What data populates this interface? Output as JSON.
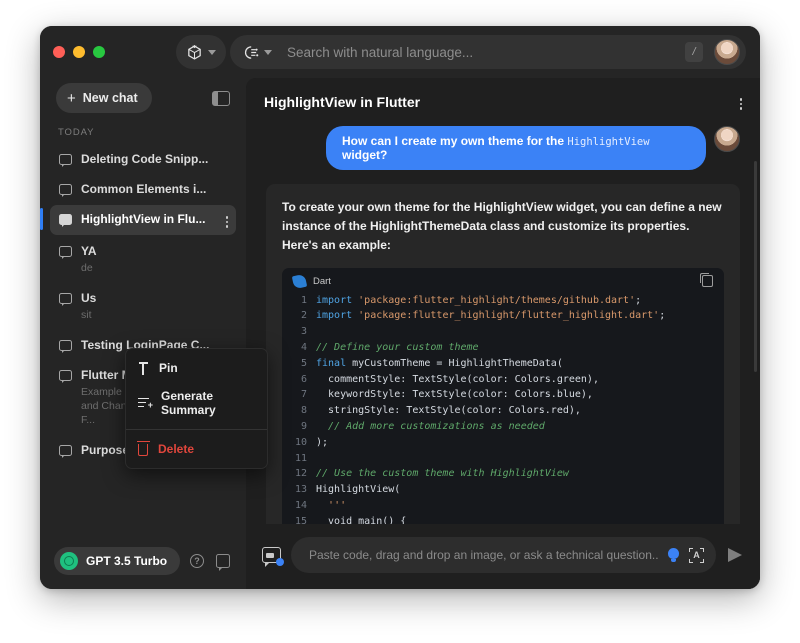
{
  "window": {
    "traffic_lights": [
      "close",
      "minimize",
      "maximize"
    ]
  },
  "toolbar": {
    "cube_icon": "cube-icon",
    "cube_caret": "chevron-down-icon",
    "brain_icon": "brain-plug-icon",
    "brain_caret": "chevron-down-icon",
    "search_placeholder": "Search with natural language...",
    "slash_shortcut": "/",
    "avatar": "user-avatar"
  },
  "sidebar": {
    "new_chat_label": "New chat",
    "panel_toggle_icon": "sidebar-toggle-icon",
    "section_label": "TODAY",
    "items": [
      {
        "title": "Deleting Code Snipp...",
        "subtitle": "",
        "active": false
      },
      {
        "title": "Common Elements i...",
        "subtitle": "",
        "active": false
      },
      {
        "title": "HighlightView in Flu...",
        "subtitle": "",
        "active": true
      },
      {
        "title": "YA",
        "subtitle": "de",
        "active": false
      },
      {
        "title": "Us",
        "subtitle": "sit",
        "active": false
      },
      {
        "title": "Testing LoginPage C...",
        "subtitle": "",
        "active": false
      },
      {
        "title": "Flutter MultiProvider...",
        "subtitle": "Example of using MultiProvider and ChangeNotifierProvider in F...",
        "active": false
      },
      {
        "title": "Purpose of allowInte...",
        "subtitle": "",
        "active": false
      }
    ],
    "context_menu": {
      "pin_label": "Pin",
      "summary_label": "Generate Summary",
      "delete_label": "Delete"
    },
    "footer": {
      "model_name": "GPT 3.5 Turbo",
      "help_icon": "help-icon",
      "help_glyph": "?",
      "feedback_icon": "feedback-icon"
    }
  },
  "main": {
    "chat_title": "HighlightView in Flutter",
    "more_icon": "kebab-menu-icon",
    "user_message": {
      "text_before": "How can I create my own theme for the ",
      "code": "HighlightView",
      "text_after": " widget?"
    },
    "assistant_message": "To create your own theme for the HighlightView widget, you can define a new instance of the HighlightThemeData class and customize its properties. Here's an example:",
    "code_block": {
      "language": "Dart",
      "language_icon": "dart-logo-icon",
      "copy_icon": "copy-icon",
      "lines": [
        {
          "n": "1",
          "html": "<span class='tok-kw'>import</span> <span class='tok-str'>'package:flutter_highlight/themes/github.dart'</span>;"
        },
        {
          "n": "2",
          "html": "<span class='tok-kw'>import</span> <span class='tok-str'>'package:flutter_highlight/flutter_highlight.dart'</span>;"
        },
        {
          "n": "3",
          "html": ""
        },
        {
          "n": "4",
          "html": "<span class='tok-cmt'>// Define your custom theme</span>"
        },
        {
          "n": "5",
          "html": "<span class='tok-kw'>final</span> myCustomTheme = HighlightThemeData("
        },
        {
          "n": "6",
          "html": "  commentStyle: TextStyle(color: Colors.green),"
        },
        {
          "n": "7",
          "html": "  keywordStyle: TextStyle(color: Colors.blue),"
        },
        {
          "n": "8",
          "html": "  stringStyle: TextStyle(color: Colors.red),"
        },
        {
          "n": "9",
          "html": "  <span class='tok-cmt'>// Add more customizations as needed</span>"
        },
        {
          "n": "10",
          "html": ");"
        },
        {
          "n": "11",
          "html": ""
        },
        {
          "n": "12",
          "html": "<span class='tok-cmt'>// Use the custom theme with HighlightView</span>"
        },
        {
          "n": "13",
          "html": "HighlightView("
        },
        {
          "n": "14",
          "html": "  <span class='tok-str'>'''</span>"
        },
        {
          "n": "15",
          "html": "  void main() {"
        }
      ]
    }
  },
  "composer": {
    "attach_icon": "attach-image-icon",
    "placeholder": "Paste code, drag and drop an image, or ask a technical question...",
    "bulb_icon": "lightbulb-icon",
    "magic_icon": "ocr-scan-icon",
    "magic_glyph": "A",
    "send_icon": "send-icon"
  },
  "colors": {
    "accent_blue": "#3b82f6",
    "danger_red": "#e0463c",
    "model_green": "#1fc07f",
    "window_bg": "#252525",
    "main_bg": "#1f1f1f",
    "code_bg": "#16181c"
  }
}
